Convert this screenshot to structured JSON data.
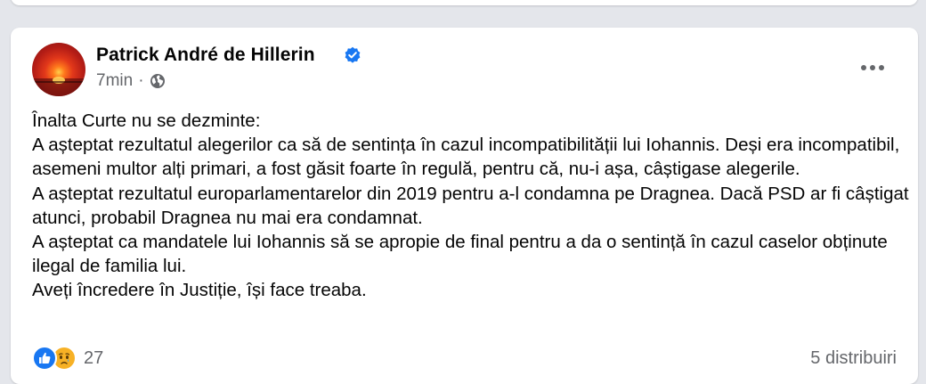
{
  "post": {
    "author": "Patrick André de Hillerin",
    "time": "7min",
    "separator": "·",
    "privacy_icon": "globe-icon",
    "verified_icon": "verified-badge-icon",
    "more_icon": "more-horizontal-icon",
    "body": "Înalta Curte nu se dezminte:\nA așteptat rezultatul alegerilor ca să de sentința în cazul incompatibilității lui Iohannis. Deși era incompatibil, asemeni multor alți primari, a fost găsit foarte în regulă, pentru că, nu-i așa, câștigase alegerile.\nA așteptat rezultatul europarlamentarelor din 2019 pentru a-l condamna pe Dragnea. Dacă PSD ar fi câștigat atunci, probabil Dragnea nu mai era condamnat.\nA așteptat ca mandatele lui Iohannis să se apropie de final pentru a da o sentință în cazul caselor obținute ilegal de familia lui.\nAveți încredere în Justiție, își face treaba.",
    "reaction_count": "27",
    "reaction_icons": [
      "like-icon",
      "sad-icon"
    ],
    "shares": "5 distribuiri"
  },
  "colors": {
    "background": "#e4e6eb",
    "card": "#ffffff",
    "text": "#050505",
    "secondary_text": "#65676b",
    "accent": "#1877f2",
    "sad": "#f7b125"
  }
}
